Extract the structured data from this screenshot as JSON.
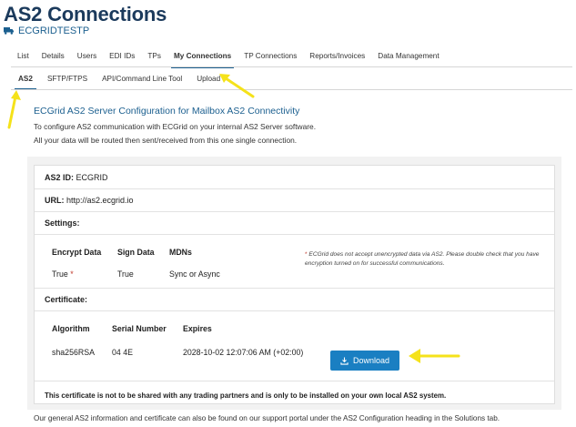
{
  "page": {
    "title": "AS2 Connections",
    "account": "ECGRIDTESTP"
  },
  "tabs_main": [
    {
      "label": "List"
    },
    {
      "label": "Details"
    },
    {
      "label": "Users"
    },
    {
      "label": "EDI IDs"
    },
    {
      "label": "TPs"
    },
    {
      "label": "My Connections",
      "active": true
    },
    {
      "label": "TP Connections"
    },
    {
      "label": "Reports/Invoices"
    },
    {
      "label": "Data Management"
    }
  ],
  "tabs_sub": [
    {
      "label": "AS2",
      "active": true
    },
    {
      "label": "SFTP/FTPS"
    },
    {
      "label": "API/Command Line Tool"
    },
    {
      "label": "Upload"
    }
  ],
  "intro": {
    "heading": "ECGrid AS2 Server Configuration for Mailbox AS2 Connectivity",
    "line1": "To configure AS2 communication with ECGrid on your internal AS2 Server software.",
    "line2": "All your data will be routed then sent/received from this one single connection."
  },
  "config": {
    "as2_id_label": "AS2 ID:",
    "as2_id_value": "ECGRID",
    "url_label": "URL:",
    "url_value": "http://as2.ecgrid.io",
    "settings_label": "Settings:",
    "settings_headers": {
      "encrypt": "Encrypt Data",
      "sign": "Sign Data",
      "mdns": "MDNs"
    },
    "settings_values": {
      "encrypt": "True",
      "encrypt_mark": "*",
      "sign": "True",
      "mdns": "Sync or Async"
    },
    "note_mark": "*",
    "note_text": "ECGrid does not accept unencrypted data via AS2. Please double check that you have encryption turned on for successful communications.",
    "certificate_label": "Certificate:",
    "cert_headers": {
      "algorithm": "Algorithm",
      "serial": "Serial Number",
      "expires": "Expires"
    },
    "cert_values": {
      "algorithm": "sha256RSA",
      "serial": "04 4E",
      "expires": "2028-10-02 12:07:06 AM (+02:00)"
    },
    "download_label": "Download",
    "warning": "This certificate is not to be shared with any trading partners and is only to be installed on your own local AS2 system."
  },
  "footer": "Our general AS2 information and certificate can also be found on our support portal under the AS2 Configuration heading in the Solutions tab.",
  "colors": {
    "brand": "#1b3a5c",
    "accent": "#1b5f8f",
    "button": "#1a7fc2",
    "annotation_arrow": "#f5e21a"
  },
  "icons": {
    "account": "truck-icon",
    "download": "download-icon",
    "annotation": "arrow-icon"
  }
}
